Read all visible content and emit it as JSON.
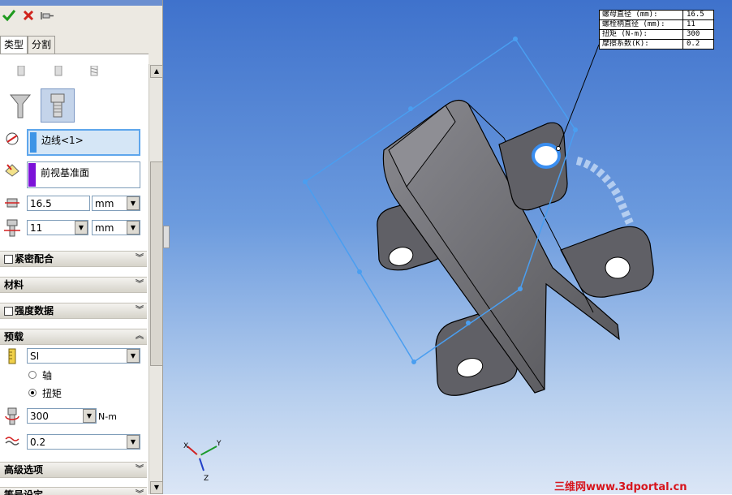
{
  "toolbar": {
    "ok": "✔",
    "cancel": "✖",
    "pin": "push-pin-icon"
  },
  "tabs": [
    {
      "label": "类型"
    },
    {
      "label": "分割"
    }
  ],
  "selections": {
    "edge": "边线<1>",
    "plane": "前视基准面",
    "edge_color": "#3d94e6",
    "plane_color": "#7b12d8"
  },
  "fields": {
    "nut_diameter": {
      "value": "16.5",
      "unit": "mm"
    },
    "bolt_diameter": {
      "value": "11",
      "unit": "mm"
    }
  },
  "sections": {
    "tight_fit": "紧密配合",
    "material": "材料",
    "strength": "强度数据",
    "preload": "预载",
    "advanced": "高级选项",
    "display": "等号设定"
  },
  "preload": {
    "unit_system": "SI",
    "option_axial": "轴",
    "option_torque": "扭矩",
    "torque_value": "300",
    "torque_unit": "N-m",
    "friction": "0.2"
  },
  "callout": [
    {
      "key": "螺母直径 (mm):",
      "value": "16.5"
    },
    {
      "key": "螺栓柄直径 (mm):",
      "value": "11"
    },
    {
      "key": "扭矩 (N-m):",
      "value": "300"
    },
    {
      "key": "摩擦系数(K):",
      "value": "0.2"
    }
  ],
  "triad": {
    "x": "X",
    "y": "Y",
    "z": "Z"
  },
  "watermark": "三维网www.3dportal.cn",
  "colors": {
    "selection_blue": "#4a9ef0",
    "part_gray": "#6a6a70",
    "watermark_red": "#d7151d"
  }
}
